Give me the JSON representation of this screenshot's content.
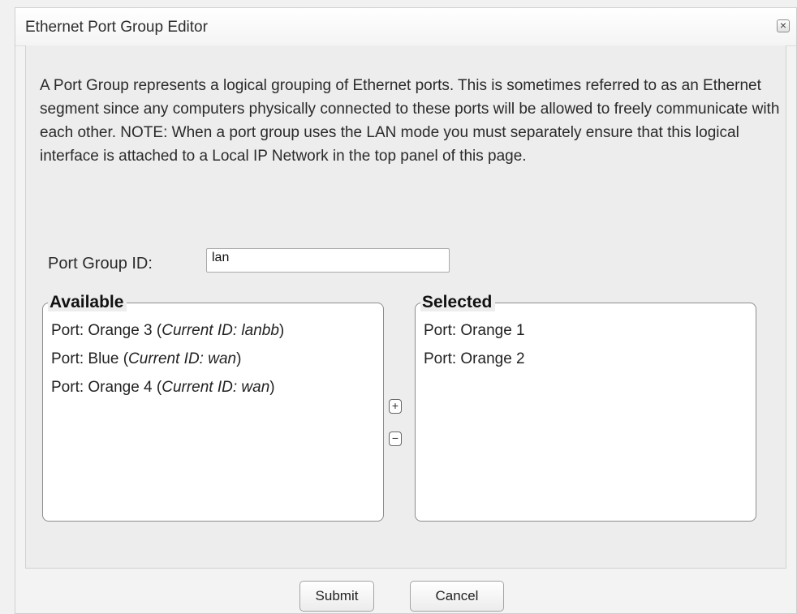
{
  "dialog": {
    "title": "Ethernet Port Group Editor",
    "close_glyph": "×",
    "description": "A Port Group represents a logical grouping of Ethernet ports. This is sometimes referred to as an Ethernet segment since any computers physically connected to these ports will be allowed to freely communicate with each other. NOTE: When a port group uses the LAN mode you must separately ensure that this logical interface is attached to a Local IP Network in the top panel of this page.",
    "port_group_id": {
      "label": "Port Group ID:",
      "value": "lan"
    },
    "available": {
      "legend": "Available",
      "items": [
        {
          "port": "Port: Orange 3",
          "open": "(",
          "current_id": "Current ID: lanbb",
          "close": ")"
        },
        {
          "port": "Port: Blue",
          "open": "(",
          "current_id": "Current ID: wan",
          "close": ")"
        },
        {
          "port": "Port: Orange 4",
          "open": "(",
          "current_id": "Current ID: wan",
          "close": ")"
        }
      ]
    },
    "selected": {
      "legend": "Selected",
      "items": [
        {
          "port": "Port: Orange 1"
        },
        {
          "port": "Port: Orange 2"
        }
      ]
    },
    "add_glyph": "+",
    "remove_glyph": "−",
    "buttons": {
      "submit": "Submit",
      "cancel": "Cancel"
    }
  }
}
